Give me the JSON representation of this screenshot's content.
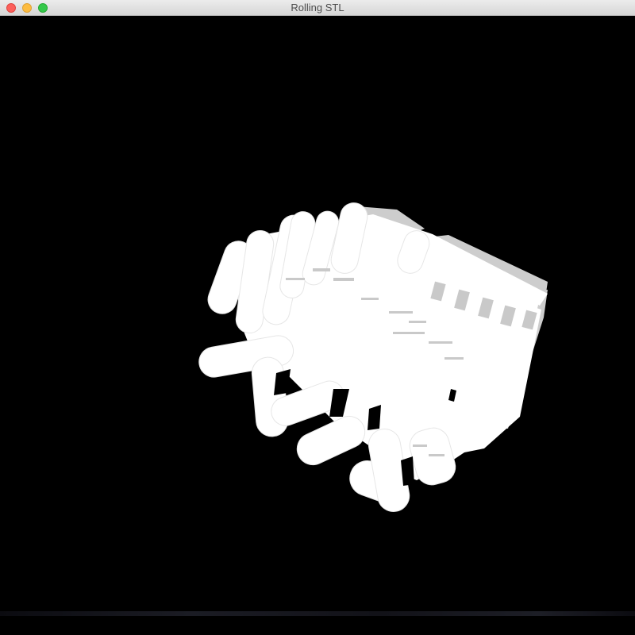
{
  "window": {
    "title": "Rolling STL",
    "controls": {
      "close_icon": "close-icon",
      "minimize_icon": "minimize-icon",
      "zoom_icon": "zoom-icon"
    }
  },
  "colors": {
    "titlebar": "#e3e3e3",
    "background": "#000000",
    "model_fill": "#ffffff",
    "model_shadow": "#cccccc",
    "close": "#fc605b",
    "minimize": "#fdbc40",
    "zoom": "#34c84a"
  },
  "viewport": {
    "content": "3d-rendered-stl-model"
  }
}
